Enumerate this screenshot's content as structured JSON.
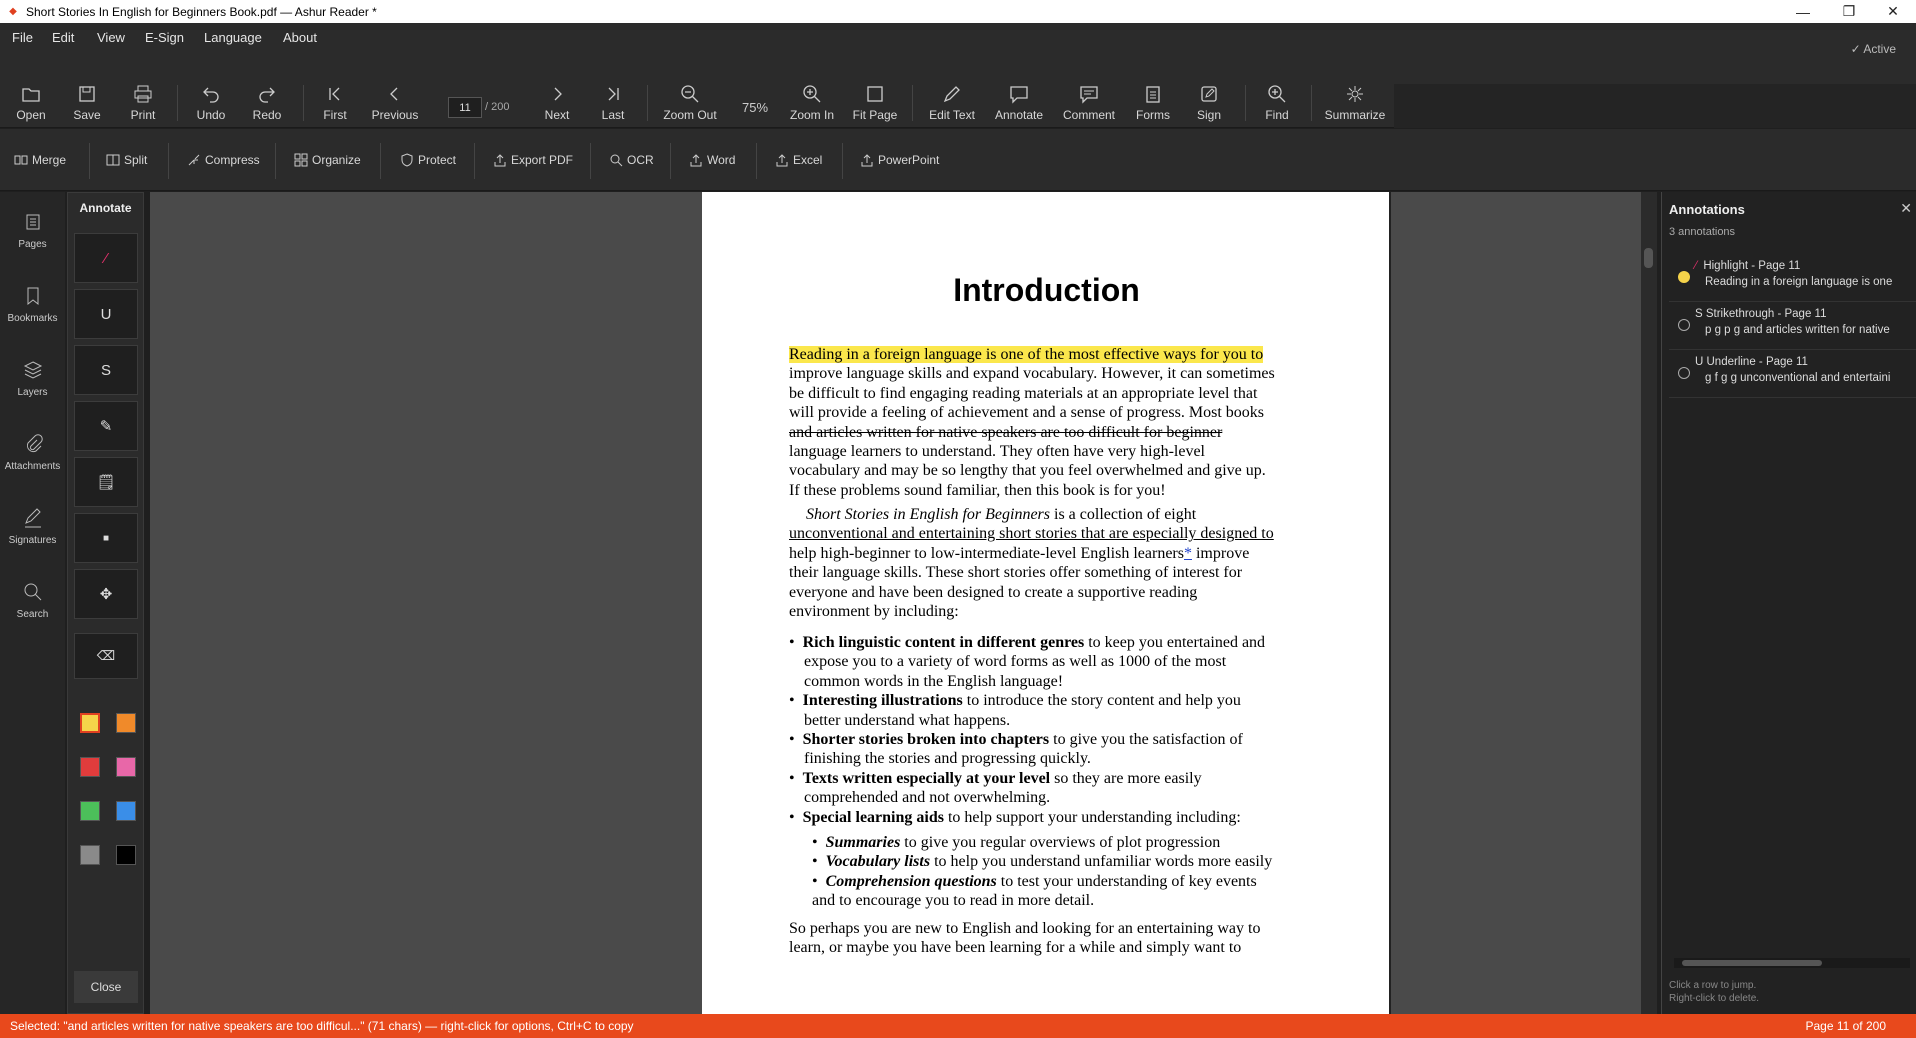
{
  "window": {
    "title": "Short Stories In English for Beginners Book.pdf — Ashur Reader *"
  },
  "menu": {
    "items": [
      "File",
      "Edit",
      "View",
      "E-Sign",
      "Language",
      "About"
    ],
    "status": "✓ Active"
  },
  "toolbar": {
    "open": "Open",
    "save": "Save",
    "print": "Print",
    "undo": "Undo",
    "redo": "Redo",
    "first": "First",
    "previous": "Previous",
    "page_current": "11",
    "page_total": "/ 200",
    "next": "Next",
    "last": "Last",
    "zoom_out": "Zoom Out",
    "zoom_value": "75%",
    "zoom_in": "Zoom In",
    "fit_page": "Fit Page",
    "edit_text": "Edit Text",
    "annotate": "Annotate",
    "comment": "Comment",
    "forms": "Forms",
    "sign": "Sign",
    "find": "Find",
    "summarize": "Summarize"
  },
  "tools": {
    "merge": "Merge",
    "split": "Split",
    "compress": "Compress",
    "organize": "Organize",
    "protect": "Protect",
    "export_pdf": "Export PDF",
    "ocr": "OCR",
    "word": "Word",
    "excel": "Excel",
    "powerpoint": "PowerPoint"
  },
  "sidebar": {
    "pages": "Pages",
    "bookmarks": "Bookmarks",
    "layers": "Layers",
    "attachments": "Attachments",
    "signatures": "Signatures",
    "search": "Search"
  },
  "annotate_panel": {
    "title": "Annotate",
    "underline_tool": "U",
    "strike_tool": "S",
    "close": "Close",
    "colors": [
      "#f5d34a",
      "#f08a2a",
      "#e03c3c",
      "#e867a8",
      "#4cbf5a",
      "#3a8ee8",
      "#8a8a8a",
      "#000000"
    ]
  },
  "document": {
    "heading": "Introduction",
    "p1_l1": "Reading in a foreign language is one of the most effective ways for you to",
    "p1_l2": "improve language skills and expand vocabulary. However, it can sometimes",
    "p1_l3": "be difficult to find engaging reading materials at an appropriate level that",
    "p1_l4": "will provide a feeling of achievement and a sense of progress. Most books",
    "p1_l5": "and articles written for native speakers are too difficult for beginner",
    "p1_l6": "language learners to understand. They often have very high-level",
    "p1_l7": "vocabulary and may be so lengthy that you feel overwhelmed and give up.",
    "p1_l8": "If these problems sound familiar, then this book is for you!",
    "p2_title": "Short Stories in English for Beginners",
    "p2_l1_rest": " is a collection of eight",
    "p2_l2": "unconventional and entertaining short stories that are especially designed to",
    "p2_l3a": "help high-beginner to low-intermediate-level English learners",
    "p2_link": "*",
    "p2_l3b": " improve",
    "p2_l4": "their language skills. These short stories offer something of interest for",
    "p2_l5": "everyone and have been designed to create a supportive reading",
    "p2_l6": "environment by including:",
    "b1_bold": "Rich linguistic content in different genres",
    "b1_rest": " to keep you entertained and",
    "b1_l2": "expose you to a variety of word forms as well as 1000 of the most",
    "b1_l3": "common words in the English language!",
    "b2_bold": "Interesting illustrations",
    "b2_rest": " to introduce the story content and help you",
    "b2_l2": "better understand what happens.",
    "b3_bold": "Shorter stories broken into chapters",
    "b3_rest": " to give you the satisfaction of",
    "b3_l2": "finishing the stories and progressing quickly.",
    "b4_bold": "Texts written especially at your level",
    "b4_rest": " so they are more easily",
    "b4_l2": "comprehended and not overwhelming.",
    "b5_bold": "Special learning aids",
    "b5_rest": " to help support your understanding including:",
    "s1_bold": "Summaries",
    "s1_rest": " to give you regular overviews of plot progression",
    "s2_bold": "Vocabulary lists",
    "s2_rest": " to help you understand unfamiliar words more easily",
    "s3_bold": "Comprehension questions",
    "s3_rest": " to test your understanding of key events",
    "s3_l2": "and to encourage you to read in more detail.",
    "p3_l1": "So perhaps you are new to English and looking for an entertaining way to",
    "p3_l2": "learn, or maybe you have been learning for a while and simply want to",
    "bullet": "•"
  },
  "annotations": {
    "title": "Annotations",
    "count": "3 annotations",
    "items": [
      {
        "title": "Highlight - Page 11",
        "text": "Reading in a foreign language is one",
        "color": "#f5d34a"
      },
      {
        "title": "S  Strikethrough - Page 11",
        "text": "p g p g and articles written for native"
      },
      {
        "title": "U  Underline - Page 11",
        "text": "g f g g unconventional and entertaini"
      }
    ],
    "hint1": "Click a row to jump.",
    "hint2": "Right-click to delete."
  },
  "status": {
    "selection": "Selected: \"and articles written for native speakers are too difficul...\" (71 chars) — right-click for options, Ctrl+C to copy",
    "page": "Page 11 of 200"
  }
}
